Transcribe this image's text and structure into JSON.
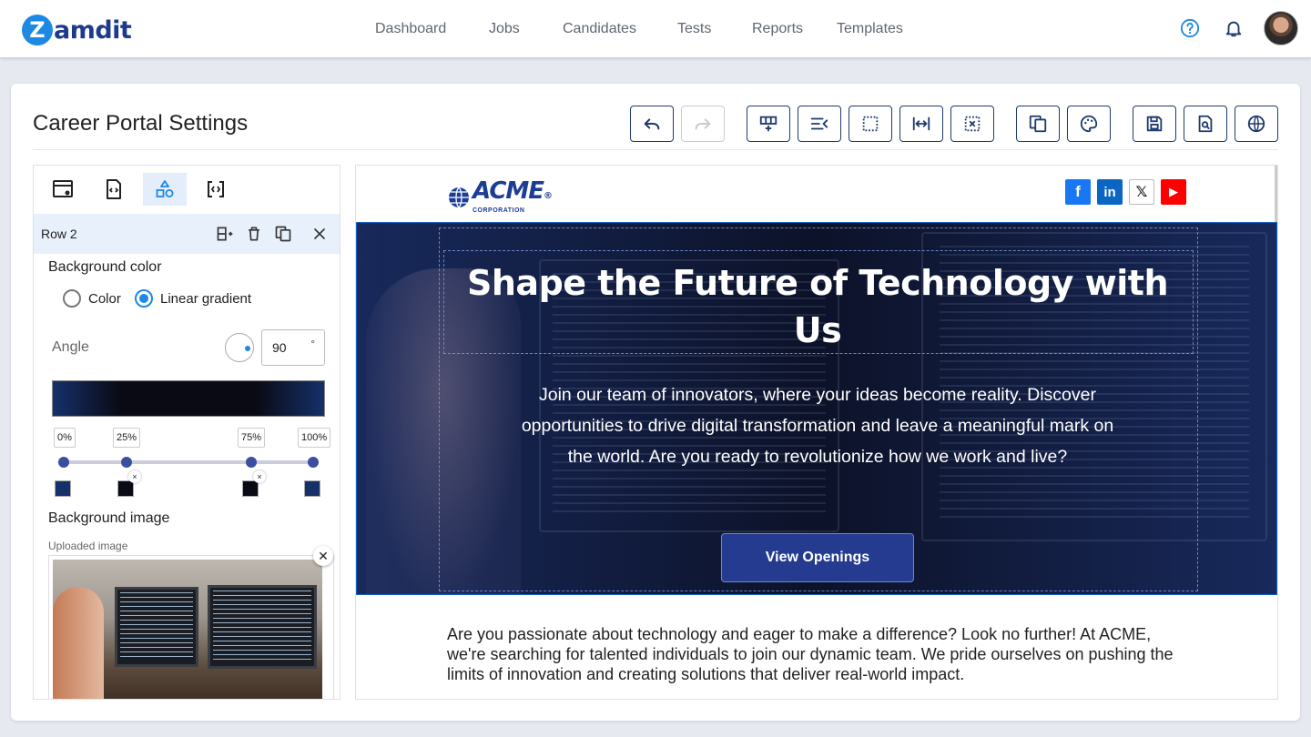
{
  "app": {
    "logo_letter": "Z",
    "logo_text": "amdit",
    "nav": [
      "Dashboard",
      "Jobs",
      "Candidates",
      "Tests",
      "Reports",
      "Templates"
    ]
  },
  "page": {
    "title": "Career Portal Settings"
  },
  "toolbar": {
    "buttons": [
      "undo",
      "redo",
      "add-row",
      "align-text",
      "select-area",
      "fit-width",
      "clear-selection",
      "duplicate-page",
      "theme-palette",
      "save",
      "preview",
      "publish"
    ]
  },
  "panel": {
    "row_label": "Row 2",
    "background_color_label": "Background color",
    "option_color": "Color",
    "option_gradient": "Linear gradient",
    "selected_option": "Linear gradient",
    "angle_label": "Angle",
    "angle_value": "90",
    "angle_unit": "°",
    "gradient_stops": [
      {
        "label": "0%",
        "color": "#16306a"
      },
      {
        "label": "25%",
        "color": "#0a0a14"
      },
      {
        "label": "75%",
        "color": "#0a0a14"
      },
      {
        "label": "100%",
        "color": "#16306a"
      }
    ],
    "remove_stop_symbol": "×",
    "background_image_label": "Background image",
    "uploaded_image_label": "Uploaded image",
    "close_symbol": "✕"
  },
  "preview": {
    "brand_name": "ACME",
    "brand_sub": "CORPORATION",
    "brand_reg": "®",
    "social": [
      {
        "name": "facebook",
        "glyph": "f",
        "color": "#1877f2"
      },
      {
        "name": "linkedin",
        "glyph": "in",
        "color": "#0a66c2"
      },
      {
        "name": "x",
        "glyph": "𝕏",
        "color": "#ffffff"
      },
      {
        "name": "youtube",
        "glyph": "▶",
        "color": "#ff0000"
      }
    ],
    "hero_title": "Shape the Future of Technology with Us",
    "hero_text": "Join our team of innovators, where your ideas become reality. Discover opportunities to drive digital transformation and leave a meaningful mark on the world. Are you ready to revolutionize how we work and live?",
    "cta_label": "View Openings",
    "body_text": "Are you passionate about technology and eager to make a difference? Look no further! At ACME, we're searching for talented individuals to join our dynamic team. We pride ourselves on pushing the limits of innovation and creating solutions that deliver real-world impact."
  },
  "colors": {
    "accent": "#1e88e5",
    "brand_navy": "#1e3a6e",
    "cta": "#253b8f"
  }
}
